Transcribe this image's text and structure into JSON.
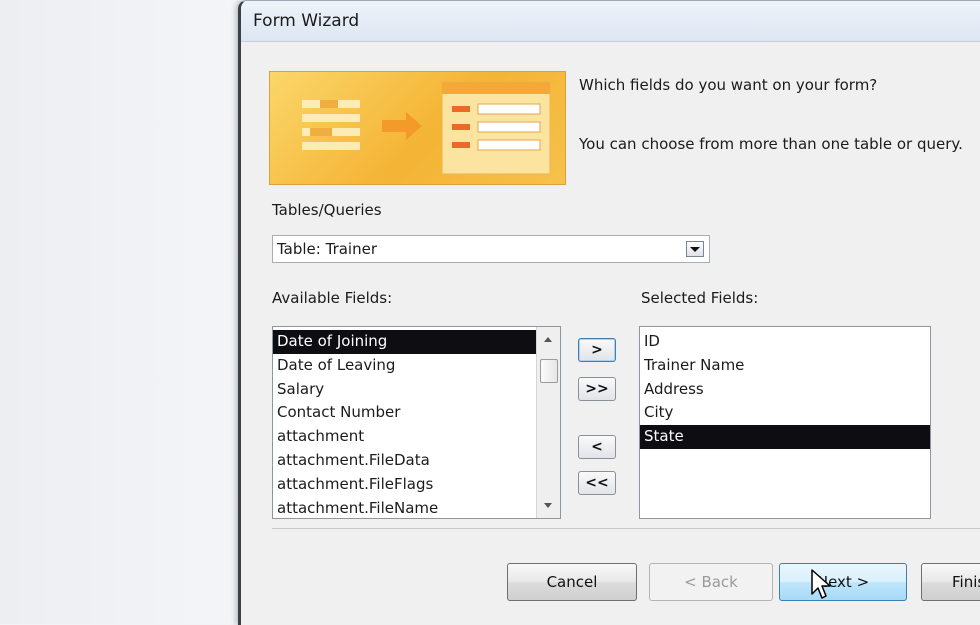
{
  "window": {
    "title": "Form Wizard"
  },
  "intro": {
    "question": "Which fields do you want on your form?",
    "hint": "You can choose from more than one table or query."
  },
  "tables_queries": {
    "label": "Tables/Queries",
    "selected": "Table: Trainer"
  },
  "available_fields": {
    "label": "Available Fields:",
    "items": [
      "Date of Joining",
      "Date of Leaving",
      "Salary",
      "Contact Number",
      "attachment",
      "attachment.FileData",
      "attachment.FileFlags",
      "attachment.FileName"
    ],
    "selected_index": 0
  },
  "selected_fields": {
    "label": "Selected Fields:",
    "items": [
      "ID",
      "Trainer Name",
      "Address",
      "City",
      "State"
    ],
    "selected_index": 4
  },
  "move_buttons": {
    "add_one": ">",
    "add_all": ">>",
    "remove_one": "<",
    "remove_all": "<<"
  },
  "footer": {
    "cancel": "Cancel",
    "back": "< Back",
    "next": "Next >",
    "finish": "Finish"
  },
  "colors": {
    "selection": "#0d0d12",
    "graphic": "#f4b434",
    "hover_button": "#bee6fd"
  }
}
